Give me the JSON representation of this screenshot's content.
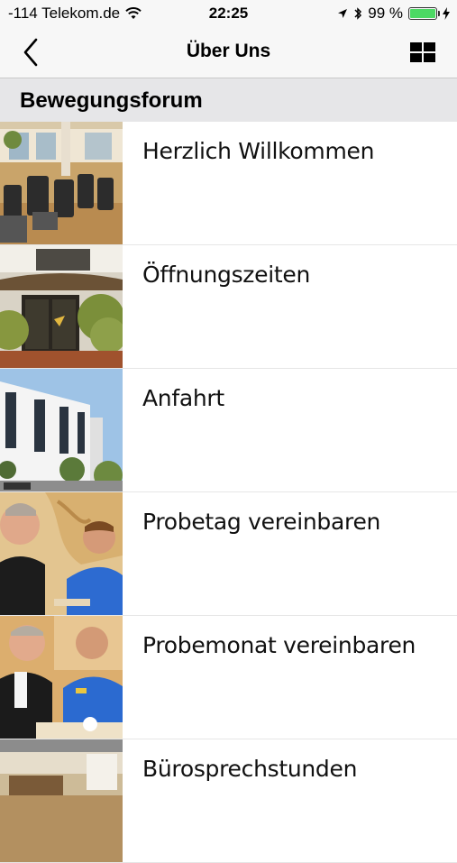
{
  "status_bar": {
    "carrier": "-114 Telekom.de",
    "time": "22:25",
    "battery": "99 %",
    "battery_level": 0.99
  },
  "nav": {
    "title": "Über Uns",
    "back_icon": "chevron-left-icon",
    "menu_icon": "grid-icon"
  },
  "section": {
    "title": "Bewegungsforum"
  },
  "items": [
    {
      "label": "Herzlich Willkommen",
      "thumbnail": "gym-equipment-photo"
    },
    {
      "label": "Öffnungszeiten",
      "thumbnail": "entrance-photo"
    },
    {
      "label": "Anfahrt",
      "thumbnail": "building-photo"
    },
    {
      "label": "Probetag vereinbaren",
      "thumbnail": "consultation-photo"
    },
    {
      "label": "Probemonat vereinbaren",
      "thumbnail": "consultation-photo-2"
    },
    {
      "label": "Bürosprechstunden",
      "thumbnail": "cafe-photo"
    }
  ]
}
